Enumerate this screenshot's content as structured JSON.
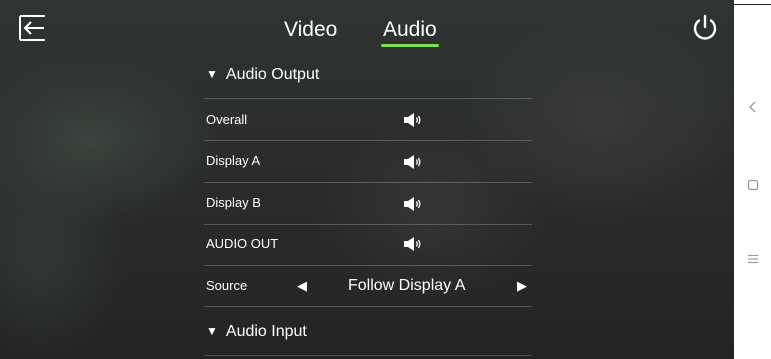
{
  "tabs": [
    {
      "label": "Video",
      "active": false
    },
    {
      "label": "Audio",
      "active": true
    }
  ],
  "accent_color": "#7ee34e",
  "sections": {
    "audio_output": {
      "title": "Audio Output",
      "expanded": true
    },
    "audio_input": {
      "title": "Audio Input",
      "expanded": true
    }
  },
  "outputs": [
    {
      "label": "Overall",
      "icon": "speaker-icon"
    },
    {
      "label": "Display A",
      "icon": "speaker-icon"
    },
    {
      "label": "Display B",
      "icon": "speaker-icon"
    },
    {
      "label": "AUDIO OUT",
      "icon": "speaker-icon"
    }
  ],
  "source": {
    "label": "Source",
    "value": "Follow Display A"
  },
  "icons": {
    "back": "exit-arrow-icon",
    "power": "power-icon",
    "nav_back": "chevron-left-icon",
    "nav_home": "square-icon",
    "nav_menu": "menu-icon"
  }
}
